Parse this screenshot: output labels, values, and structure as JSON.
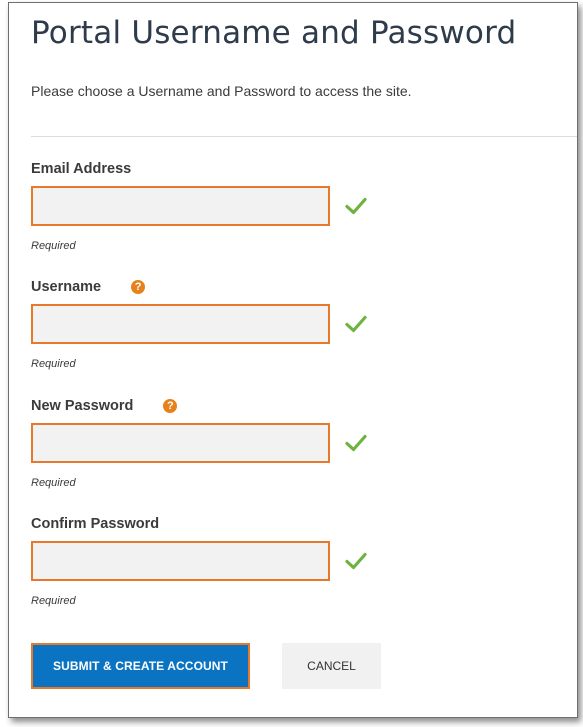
{
  "page": {
    "title": "Portal Username and Password",
    "subtitle": "Please choose a Username and Password to access the site."
  },
  "fields": {
    "email": {
      "label": "Email Address",
      "value": "",
      "required_note": "Required",
      "valid": true
    },
    "username": {
      "label": "Username",
      "value": "",
      "required_note": "Required",
      "valid": true,
      "help_icon": "?"
    },
    "new_password": {
      "label": "New Password",
      "value": "",
      "required_note": "Required",
      "valid": true,
      "help_icon": "?"
    },
    "confirm_password": {
      "label": "Confirm Password",
      "value": "",
      "required_note": "Required",
      "valid": true
    }
  },
  "buttons": {
    "submit_label": "SUBMIT & CREATE ACCOUNT",
    "cancel_label": "CANCEL"
  },
  "icons": {
    "valid": "check-icon",
    "help": "question-circle-icon"
  },
  "colors": {
    "accent_orange": "#e6792b",
    "help_orange": "#e7811c",
    "valid_green": "#6cb33f",
    "primary_blue": "#0b74c2",
    "title_text": "#2e3b4a"
  }
}
